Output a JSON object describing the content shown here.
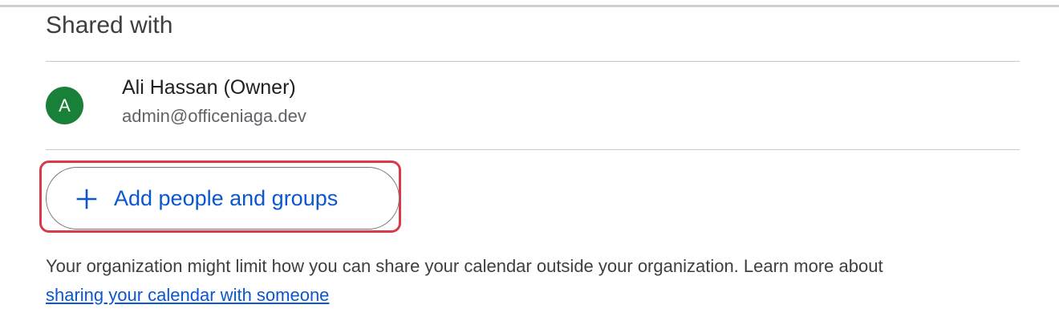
{
  "section": {
    "title": "Shared with"
  },
  "owner": {
    "avatar_letter": "A",
    "avatar_color": "#188038",
    "name": "Ali Hassan (Owner)",
    "email": "admin@officeniaga.dev"
  },
  "add_button": {
    "label": "Add people and groups",
    "icon": "plus-icon",
    "accent_color": "#0b57d0"
  },
  "highlight_color": "#d93a4a",
  "info": {
    "text": "Your organization might limit how you can share your calendar outside your organization. Learn more about",
    "link_text": "sharing your calendar with someone"
  }
}
